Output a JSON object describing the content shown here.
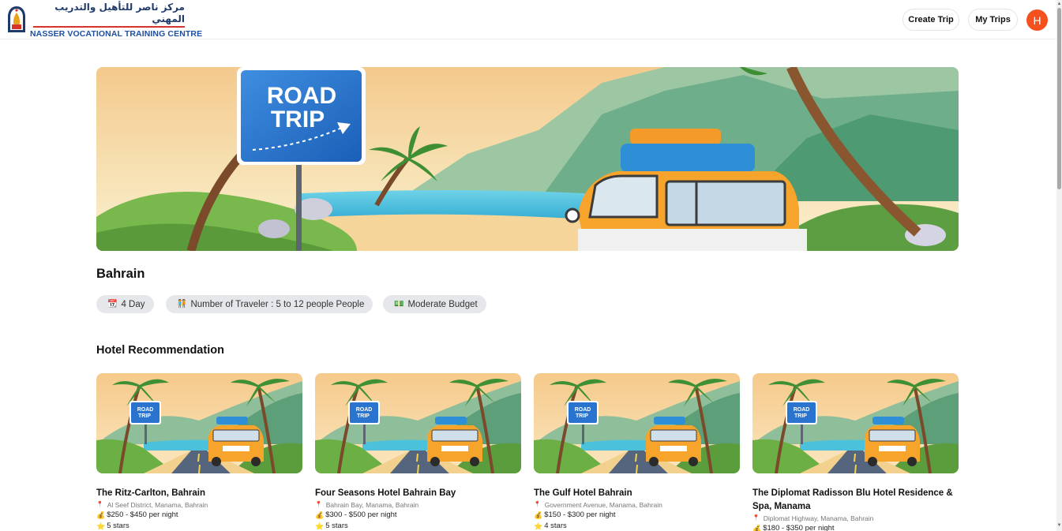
{
  "header": {
    "logo_ar": "مركز ناصر للتأهيل والتدريب المهني",
    "logo_en": "NASSER VOCATIONAL TRAINING CENTRE",
    "create_trip_label": "Create Trip",
    "my_trips_label": "My Trips",
    "avatar_initial": "H"
  },
  "hero": {
    "sign_line1": "ROAD",
    "sign_line2": "TRIP"
  },
  "trip": {
    "destination": "Bahrain",
    "days_icon": "calendar-icon",
    "days": "4 Day",
    "travelers_icon": "people-icon",
    "travelers": "Number of Traveler : 5 to 12 people People",
    "budget_icon": "money-icon",
    "budget": "Moderate Budget"
  },
  "hotels": {
    "title": "Hotel Recommendation",
    "items": [
      {
        "name": "The Ritz-Carlton, Bahrain",
        "address": "Al Seef District, Manama, Bahrain",
        "price": "$250 - $450 per night",
        "rating": "5 stars"
      },
      {
        "name": "Four Seasons Hotel Bahrain Bay",
        "address": "Bahrain Bay, Manama, Bahrain",
        "price": "$300 - $500 per night",
        "rating": "5 stars"
      },
      {
        "name": "The Gulf Hotel Bahrain",
        "address": "Government Avenue, Manama, Bahrain",
        "price": "$150 - $300 per night",
        "rating": "4 stars"
      },
      {
        "name": "The Diplomat Radisson Blu Hotel Residence & Spa, Manama",
        "address": "Diplomat Highway, Manama, Bahrain",
        "price": "$180 - $350 per night",
        "rating": ""
      }
    ]
  },
  "colors": {
    "avatar": "#f4511e",
    "chip_bg": "#e5e7eb",
    "pin": "#e91e63"
  }
}
